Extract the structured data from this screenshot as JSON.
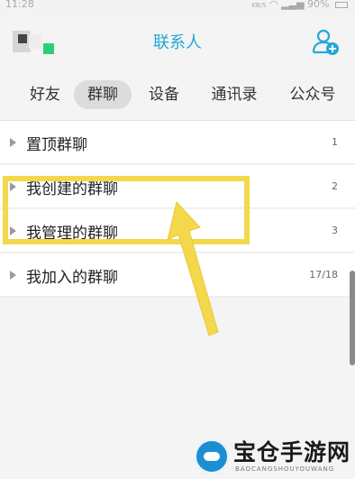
{
  "status_bar": {
    "time": "11:28",
    "net": "KB/S",
    "battery": "90%"
  },
  "header": {
    "title": "联系人",
    "add_icon": "add-contact-icon",
    "accent": "#22a8d6"
  },
  "tabs": [
    {
      "label": "好友",
      "active": false
    },
    {
      "label": "群聊",
      "active": true
    },
    {
      "label": "设备",
      "active": false
    },
    {
      "label": "通讯录",
      "active": false
    },
    {
      "label": "公众号",
      "active": false
    }
  ],
  "groups": [
    {
      "label": "置顶群聊",
      "count": "1"
    },
    {
      "label": "我创建的群聊",
      "count": "2"
    },
    {
      "label": "我管理的群聊",
      "count": "3"
    },
    {
      "label": "我加入的群聊",
      "count": "17/18"
    }
  ],
  "annotation": {
    "highlight_color": "#f3d84c"
  },
  "watermark": {
    "title": "宝仓手游网",
    "subtitle": "BAOCANGSHOUYOUWANG"
  }
}
